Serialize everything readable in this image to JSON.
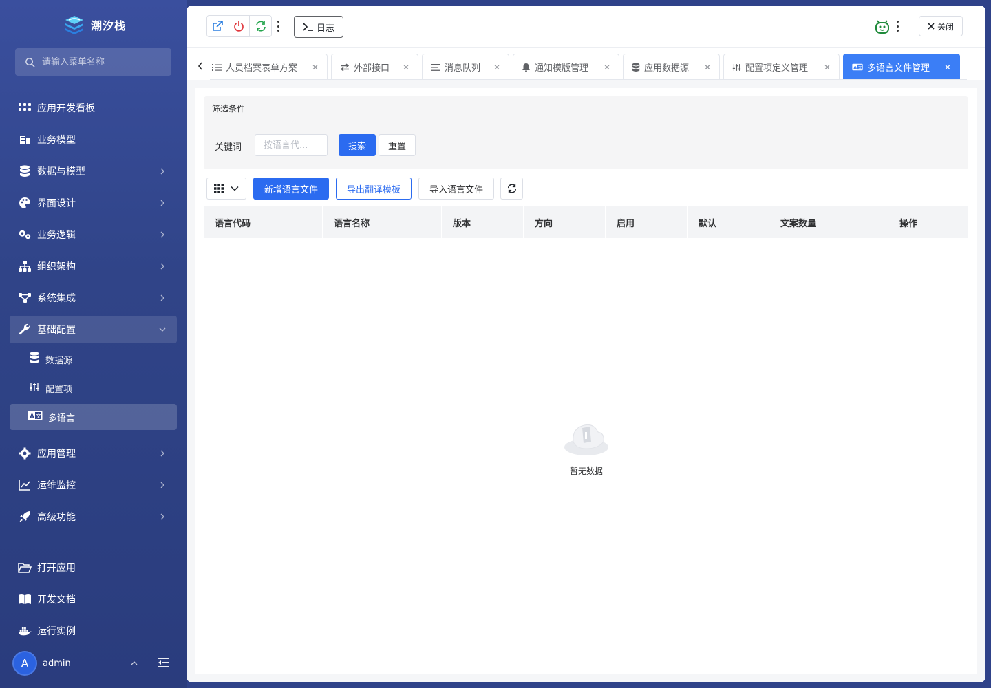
{
  "app": {
    "name": "潮汐栈"
  },
  "colors": {
    "primary": "#2b6bf0",
    "sidebar": "#304488",
    "active_tab": "#3b7ef6"
  },
  "sidebar": {
    "search_placeholder": "请输入菜单名称",
    "items": [
      {
        "label": "应用开发看板",
        "icon": "grid-dots-icon",
        "has_children": false
      },
      {
        "label": "业务模型",
        "icon": "building-icon",
        "has_children": false
      },
      {
        "label": "数据与模型",
        "icon": "database-icon",
        "has_children": true
      },
      {
        "label": "界面设计",
        "icon": "palette-icon",
        "has_children": true
      },
      {
        "label": "业务逻辑",
        "icon": "gears-icon",
        "has_children": true
      },
      {
        "label": "组织架构",
        "icon": "org-chart-icon",
        "has_children": true
      },
      {
        "label": "系统集成",
        "icon": "integration-icon",
        "has_children": true
      },
      {
        "label": "基础配置",
        "icon": "wrench-icon",
        "has_children": true,
        "expanded": true
      }
    ],
    "sub_items": [
      {
        "label": "数据源",
        "icon": "database-icon"
      },
      {
        "label": "配置项",
        "icon": "sliders-icon"
      },
      {
        "label": "多语言",
        "icon": "language-icon",
        "active": true
      }
    ],
    "items_after": [
      {
        "label": "应用管理",
        "icon": "gear-icon",
        "has_children": true
      },
      {
        "label": "运维监控",
        "icon": "line-chart-icon",
        "has_children": true
      },
      {
        "label": "高级功能",
        "icon": "rocket-icon",
        "has_children": true
      }
    ],
    "bottom_items": [
      {
        "label": "打开应用",
        "icon": "folder-open-icon"
      },
      {
        "label": "开发文档",
        "icon": "book-icon"
      },
      {
        "label": "运行实例",
        "icon": "docker-icon"
      }
    ],
    "user": {
      "initial": "A",
      "name": "admin"
    }
  },
  "toolbar": {
    "log_label": "日志",
    "close_label": "关闭"
  },
  "tabs": [
    {
      "label": "人员档案表单方案",
      "icon": "list-icon"
    },
    {
      "label": "外部接口",
      "icon": "exchange-icon"
    },
    {
      "label": "消息队列",
      "icon": "align-left-icon"
    },
    {
      "label": "通知模版管理",
      "icon": "bell-icon"
    },
    {
      "label": "应用数据源",
      "icon": "database-icon"
    },
    {
      "label": "配置项定义管理",
      "icon": "sliders-icon"
    },
    {
      "label": "多语言文件管理",
      "icon": "language-icon",
      "active": true
    }
  ],
  "filter": {
    "title": "筛选条件",
    "keyword_label": "关键词",
    "keyword_placeholder": "按语言代...",
    "search_label": "搜索",
    "reset_label": "重置"
  },
  "actions": {
    "add_label": "新增语言文件",
    "export_label": "导出翻译模板",
    "import_label": "导入语言文件"
  },
  "table": {
    "columns": [
      "语言代码",
      "语言名称",
      "版本",
      "方向",
      "启用",
      "默认",
      "文案数量",
      "操作"
    ],
    "rows": [],
    "empty_text": "暂无数据"
  }
}
